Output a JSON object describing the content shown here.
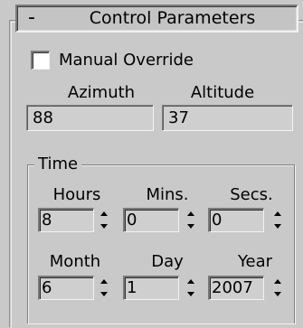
{
  "rollout": {
    "collapse_symbol": "-",
    "title": "Control Parameters"
  },
  "manual_override": {
    "label": "Manual Override",
    "checked": false
  },
  "readouts": {
    "azimuth_label": "Azimuth",
    "azimuth_value": "88",
    "altitude_label": "Altitude",
    "altitude_value": "37"
  },
  "time_group": {
    "title": "Time",
    "hours_label": "Hours",
    "hours_value": "8",
    "mins_label": "Mins.",
    "mins_value": "0",
    "secs_label": "Secs.",
    "secs_value": "0",
    "month_label": "Month",
    "month_value": "6",
    "day_label": "Day",
    "day_value": "1",
    "year_label": "Year",
    "year_value": "2007"
  }
}
